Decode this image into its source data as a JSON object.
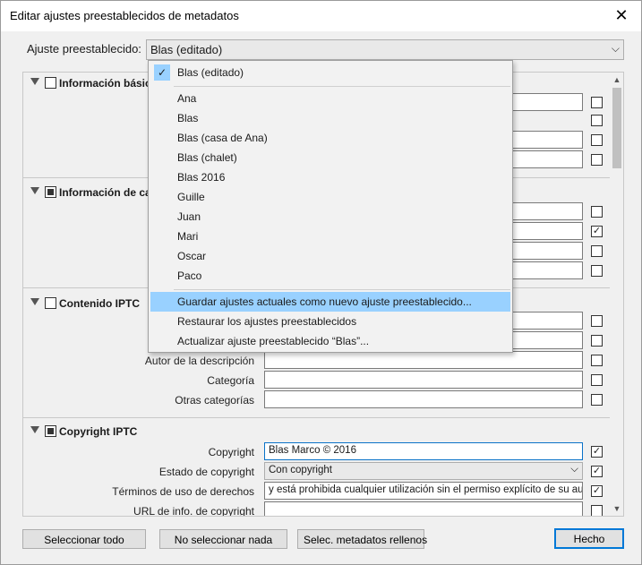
{
  "window": {
    "title": "Editar ajustes preestablecidos de metadatos",
    "close_glyph": "✕"
  },
  "preset": {
    "label": "Ajuste preestablecido:",
    "value": "Blas (editado)",
    "chevron": "⌵"
  },
  "sections": {
    "basic": {
      "title": "Información básica",
      "title_visible": "Información básic"
    },
    "camera": {
      "title": "Información de cámara",
      "title_visible": "Información de ca"
    },
    "iptc_content": {
      "title": "Contenido IPTC"
    },
    "iptc_copyright": {
      "title": "Copyright IPTC"
    }
  },
  "content_rows": [
    {
      "label": "Autor de la descripción",
      "value": "",
      "checked": false
    },
    {
      "label": "Categoría",
      "value": "",
      "checked": false
    },
    {
      "label": "Otras categorías",
      "value": "",
      "checked": false
    }
  ],
  "copyright_rows": [
    {
      "label": "Copyright",
      "value": "Blas Marco © 2016",
      "checked": true
    },
    {
      "label": "Estado de copyright",
      "value": "Con copyright",
      "checked": true
    },
    {
      "label": "Términos de uso de derechos",
      "value": "y está prohibida cualquier utilización sin el permiso explícito de su autor.",
      "checked": true
    },
    {
      "label": "URL de info. de copyright",
      "value": "",
      "checked": false
    }
  ],
  "dropdown": {
    "selected": "Blas (editado)",
    "check_glyph": "✓",
    "presets": [
      "Ana",
      "Blas",
      "Blas (casa de Ana)",
      "Blas (chalet)",
      "Blas 2016",
      "Guille",
      "Juan",
      "Mari",
      "Oscar",
      "Paco"
    ],
    "actions": [
      "Guardar ajustes actuales como nuevo ajuste preestablecido...",
      "Restaurar los ajustes preestablecidos",
      "Actualizar ajuste preestablecido “Blas”..."
    ]
  },
  "buttons": {
    "select_all": "Seleccionar todo",
    "select_none": "No seleccionar nada",
    "select_filled": "Selec. metadatos rellenos",
    "done": "Hecho"
  },
  "checkmark": "✓",
  "colors": {
    "accent": "#0078d7",
    "hover": "#99d1ff",
    "selected": "#cce8ff"
  }
}
